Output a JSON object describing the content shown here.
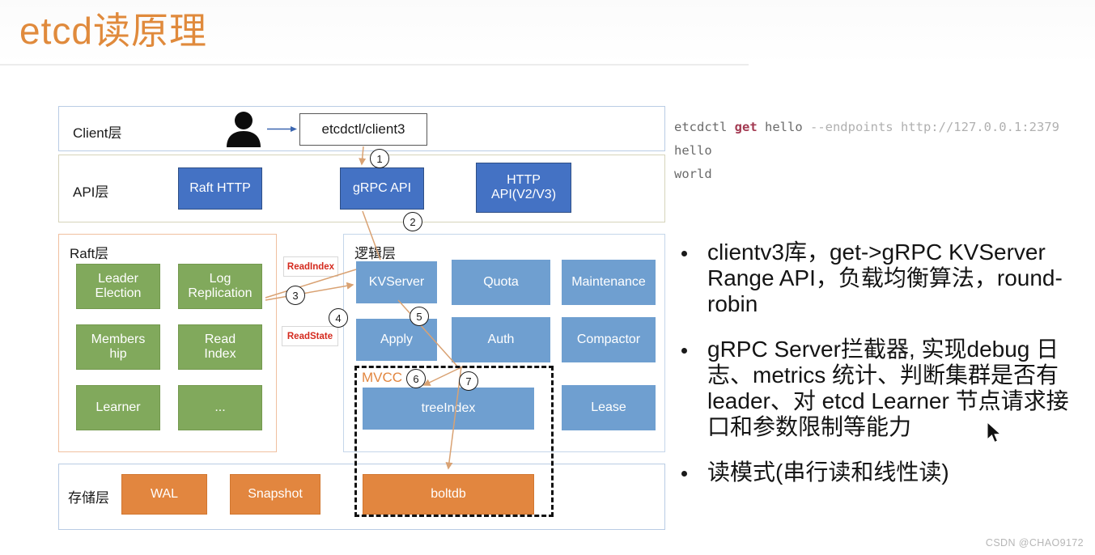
{
  "header": {
    "title": "etcd读原理",
    "title_color": "#e08a3c"
  },
  "diagram": {
    "layers": [
      {
        "id": "client",
        "label": "Client层",
        "border_color": "#b9cce4"
      },
      {
        "id": "api",
        "label": "API层",
        "border_color": "#d6d4bb"
      },
      {
        "id": "raft",
        "label": "Raft层",
        "border_color": "#f0c0a0"
      },
      {
        "id": "logic",
        "label": "逻辑层",
        "border_color": "#c5d6ea"
      },
      {
        "id": "storage",
        "label": "存储层",
        "border_color": "#b9cce4"
      }
    ],
    "client_node": "etcdctl/client3",
    "api_nodes": [
      "Raft HTTP",
      "gRPC API",
      "HTTP\nAPI(V2/V3)"
    ],
    "api_node_1": "Raft HTTP",
    "api_node_2": "gRPC API",
    "api_node_3_line1": "HTTP",
    "api_node_3_line2": "API(V2/V3)",
    "raft_nodes": [
      "Leader\nElection",
      "Log\nReplication",
      "Members\nhip",
      "Read\nIndex",
      "Learner",
      "..."
    ],
    "raft_node_1_line1": "Leader",
    "raft_node_1_line2": "Election",
    "raft_node_2_line1": "Log",
    "raft_node_2_line2": "Replication",
    "raft_node_3_line1": "Members",
    "raft_node_3_line2": "hip",
    "raft_node_4_line1": "Read",
    "raft_node_4_line2": "Index",
    "raft_node_5": "Learner",
    "raft_node_6": "...",
    "logic_nodes": [
      "KVServer",
      "Quota",
      "Maintenance",
      "Apply",
      "Auth",
      "Compactor",
      "treeIndex",
      "Lease"
    ],
    "logic_kvserver": "KVServer",
    "logic_quota": "Quota",
    "logic_maintenance": "Maintenance",
    "logic_apply": "Apply",
    "logic_auth": "Auth",
    "logic_compactor": "Compactor",
    "logic_treeindex": "treeIndex",
    "logic_lease": "Lease",
    "mvcc_label": "MVCC",
    "storage_nodes": [
      "WAL",
      "Snapshot",
      "boltdb"
    ],
    "storage_wal": "WAL",
    "storage_snapshot": "Snapshot",
    "storage_boltdb": "boltdb",
    "chips": {
      "read_index": "ReadIndex",
      "read_state": "ReadState"
    },
    "steps": [
      "1",
      "2",
      "3",
      "4",
      "5",
      "6",
      "7"
    ],
    "colors": {
      "blue_dark": "#4472c4",
      "blue_light": "#6f9fd0",
      "green": "#81a95c",
      "orange": "#e2863f"
    }
  },
  "code": {
    "line1_cmd": "etcdctl ",
    "line1_kw": "get",
    "line1_arg": " hello ",
    "line1_flag": "--endpoints http://127.0.0.1:2379",
    "line2": "hello",
    "line3": "world"
  },
  "bullets": [
    "clientv3库，get->gRPC KVServer Range API，负载均衡算法，round-robin",
    "gRPC Server拦截器, 实现debug 日志、metrics 统计、判断集群是否有leader、对 etcd Learner 节点请求接口和参数限制等能力",
    "读模式(串行读和线性读)"
  ],
  "watermark": "CSDN @CHAO9172"
}
